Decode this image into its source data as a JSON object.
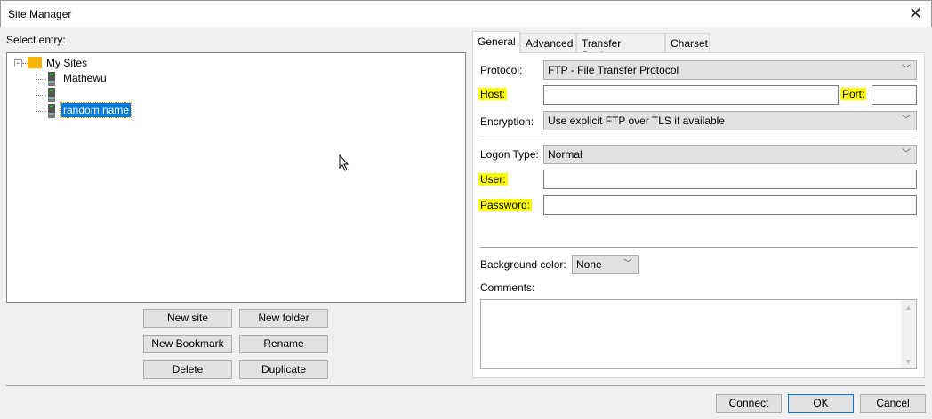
{
  "window": {
    "title": "Site Manager",
    "close": "✕"
  },
  "left": {
    "label": "Select entry:",
    "tree": {
      "root": "My Sites",
      "children": [
        "Mathewu",
        "",
        "random name"
      ],
      "selected": "random name",
      "expander": "−"
    },
    "buttons": {
      "new_site": "New site",
      "new_folder": "New folder",
      "new_bookmark": "New Bookmark",
      "rename": "Rename",
      "delete": "Delete",
      "duplicate": "Duplicate"
    }
  },
  "tabs": [
    "General",
    "Advanced",
    "Transfer Settings",
    "Charset"
  ],
  "general": {
    "protocol_label": "Protocol:",
    "protocol_value": "FTP - File Transfer Protocol",
    "host_label": "Host:",
    "host_value": "",
    "port_label": "Port:",
    "port_value": "",
    "encryption_label": "Encryption:",
    "encryption_value": "Use explicit FTP over TLS if available",
    "logon_label": "Logon Type:",
    "logon_value": "Normal",
    "user_label": "User:",
    "user_value": "",
    "password_label": "Password:",
    "password_value": "",
    "bg_label": "Background color:",
    "bg_value": "None",
    "comments_label": "Comments:",
    "comments_value": ""
  },
  "footer": {
    "connect": "Connect",
    "ok": "OK",
    "cancel": "Cancel"
  },
  "colors": {
    "highlight": "#ffff00",
    "selection": "#0078d7",
    "accent": "#0078d7"
  }
}
